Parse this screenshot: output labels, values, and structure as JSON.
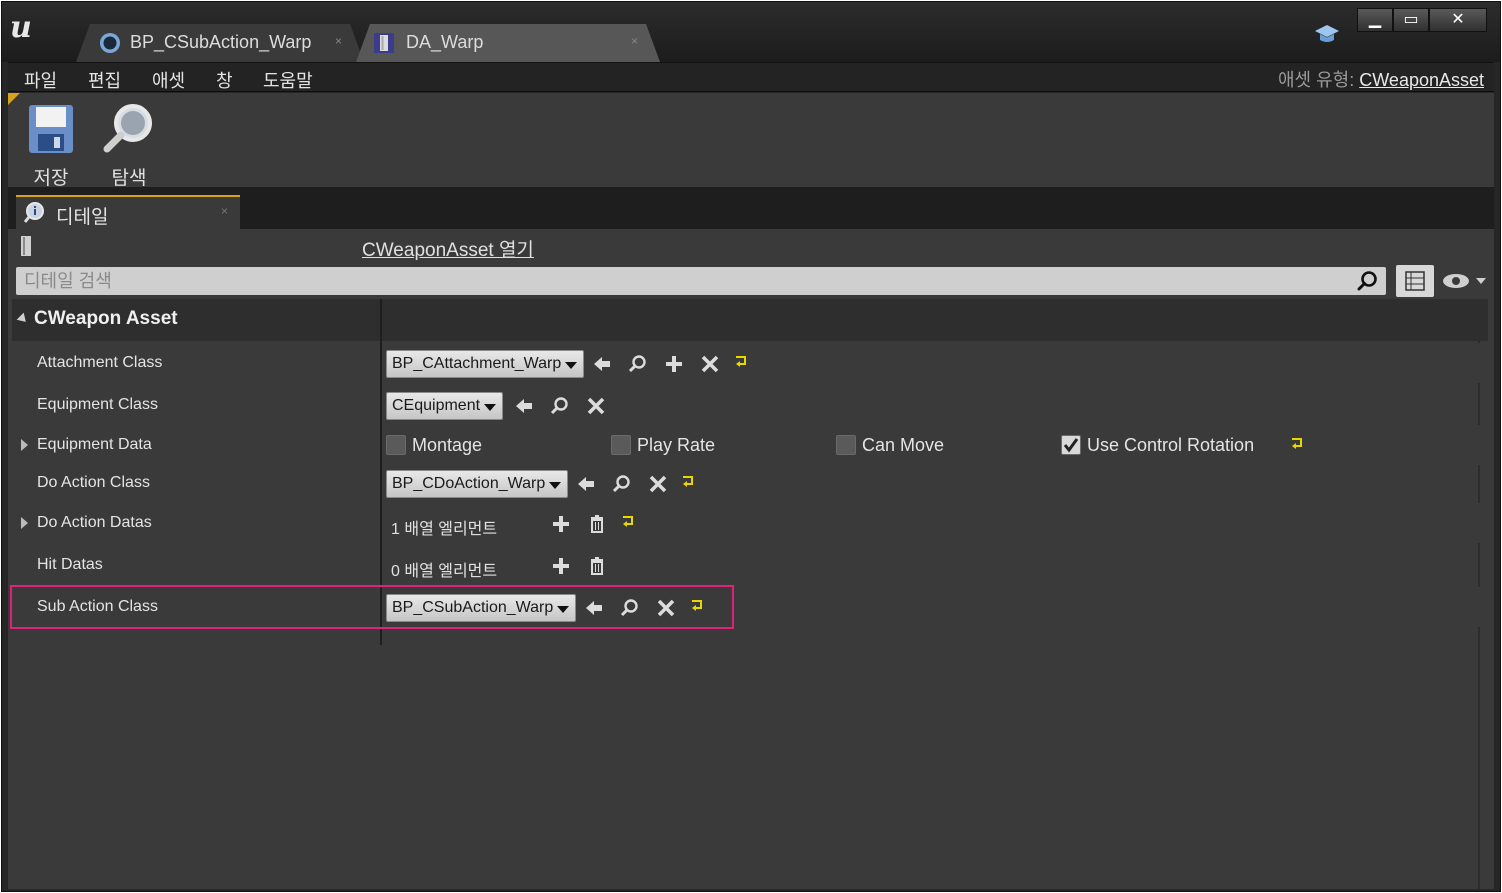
{
  "titlebar": {
    "tabs": [
      {
        "label": "BP_CSubAction_Warp",
        "close": "×",
        "icon": "blueprint-circle-icon"
      },
      {
        "label": "DA_Warp",
        "close": "×",
        "icon": "data-asset-icon"
      }
    ],
    "window_buttons": {
      "minimize": "▁",
      "maximize": "▭",
      "close": "✕"
    }
  },
  "menubar": {
    "items": [
      "파일",
      "편집",
      "애셋",
      "창",
      "도움말"
    ],
    "asset_type_label": "애셋 유형:",
    "asset_type_value": "CWeaponAsset"
  },
  "toolbar": {
    "save": "저장",
    "browse": "탐색"
  },
  "details": {
    "tab_label": "디테일",
    "tab_close": "×",
    "open_link": "CWeaponAsset 열기",
    "search_placeholder": "디테일 검색",
    "category": "CWeapon Asset",
    "rows": {
      "attachment": {
        "name": "Attachment Class",
        "value": "BP_CAttachment_Warp"
      },
      "equipment": {
        "name": "Equipment Class",
        "value": "CEquipment"
      },
      "equipment_data": {
        "name": "Equipment Data",
        "checks": [
          {
            "label": "Montage",
            "checked": false
          },
          {
            "label": "Play Rate",
            "checked": false
          },
          {
            "label": "Can Move",
            "checked": false
          },
          {
            "label": "Use Control Rotation",
            "checked": true
          }
        ]
      },
      "do_action": {
        "name": "Do Action Class",
        "value": "BP_CDoAction_Warp"
      },
      "do_action_datas": {
        "name": "Do Action Datas",
        "value": "1 배열 엘리먼트"
      },
      "hit_datas": {
        "name": "Hit Datas",
        "value": "0 배열 엘리먼트"
      },
      "sub_action": {
        "name": "Sub Action Class",
        "value": "BP_CSubAction_Warp"
      }
    }
  },
  "colors": {
    "highlight": "#e0207a",
    "reset_arrow": "#e8d800",
    "accent_tab": "#d8a21e"
  }
}
